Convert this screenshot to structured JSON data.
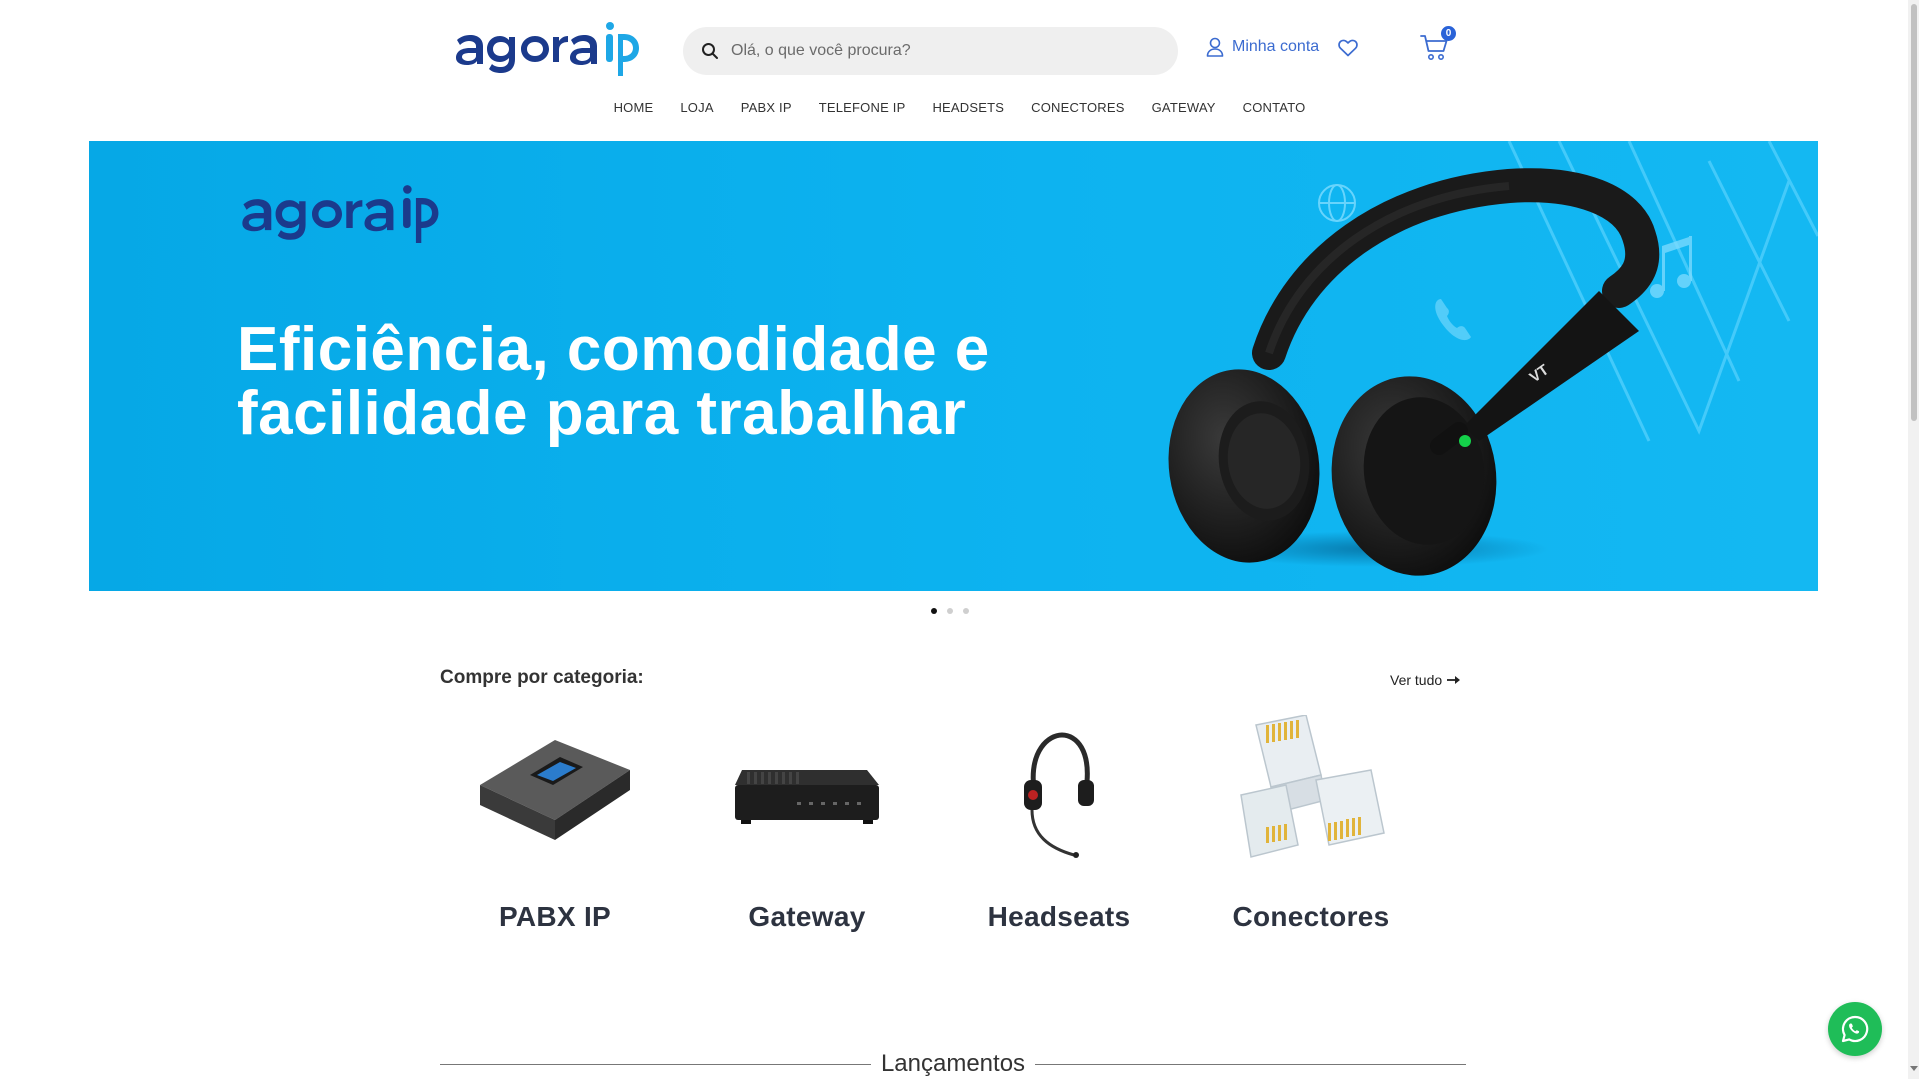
{
  "header": {
    "logo_text": "agora ip",
    "search_placeholder": "Olá, o que você procura?",
    "account_label": "Minha conta",
    "cart_count": "0"
  },
  "nav": {
    "items": [
      "HOME",
      "LOJA",
      "PABX IP",
      "TELEFONE IP",
      "HEADSETS",
      "CONECTORES",
      "GATEWAY",
      "CONTATO"
    ]
  },
  "hero": {
    "logo_text": "agora ip",
    "title_line1": "Eficiência, comodidade e",
    "title_line2": "facilidade para trabalhar",
    "slides_total": 3,
    "active_slide": 1,
    "headset_brand": "VT"
  },
  "categories": {
    "heading": "Compre por categoria:",
    "see_all": "Ver tudo",
    "items": [
      {
        "label": "PABX IP",
        "icon": "pabx-device"
      },
      {
        "label": "Gateway",
        "icon": "gateway-device"
      },
      {
        "label": "Headseats",
        "icon": "headset"
      },
      {
        "label": "Conectores",
        "icon": "rj45-connectors"
      }
    ]
  },
  "launches": {
    "heading": "Lançamentos"
  },
  "colors": {
    "brand_dark": "#1b3a8c",
    "brand_light": "#1ea7e6",
    "hero_bg": "#0db3f0",
    "accent_link": "#3b6bd0",
    "whatsapp": "#1fbd58"
  }
}
